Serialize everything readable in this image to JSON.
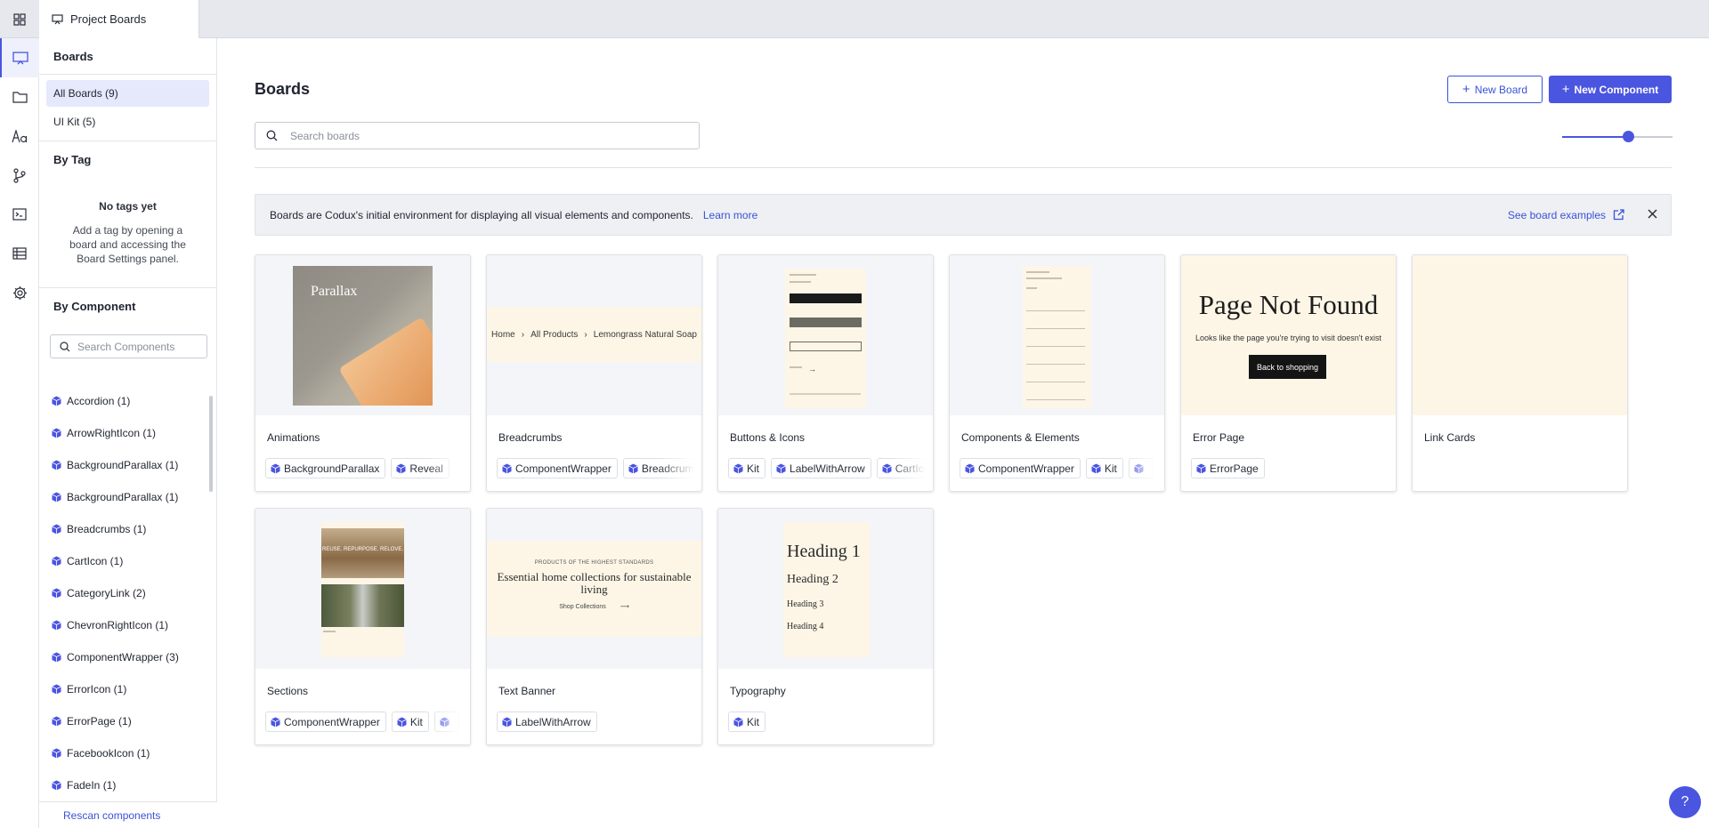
{
  "top_tab": {
    "label": "Project Boards"
  },
  "sidebar": {
    "boards_heading": "Boards",
    "board_filters": [
      {
        "label": "All Boards (9)",
        "active": true
      },
      {
        "label": "UI Kit (5)",
        "active": false
      }
    ],
    "by_tag_heading": "By Tag",
    "no_tags_title": "No tags yet",
    "no_tags_body": "Add a tag by opening a board and accessing the Board Settings panel.",
    "by_component_heading": "By Component",
    "component_search_placeholder": "Search Components",
    "components": [
      "Accordion (1)",
      "ArrowRightIcon (1)",
      "BackgroundParallax (1)",
      "BackgroundParallax (1)",
      "Breadcrumbs (1)",
      "CartIcon (1)",
      "CategoryLink (2)",
      "ChevronRightIcon (1)",
      "ComponentWrapper (3)",
      "ErrorIcon (1)",
      "ErrorPage (1)",
      "FacebookIcon (1)",
      "FadeIn (1)"
    ],
    "rescan_label": "Rescan components"
  },
  "main": {
    "title": "Boards",
    "new_board_label": "New Board",
    "new_component_label": "New Component",
    "search_placeholder": "Search boards",
    "zoom_level": 0.6,
    "banner": {
      "text": "Boards are Codux's initial environment for displaying all visual elements and components.",
      "learn_more": "Learn more",
      "examples": "See board examples"
    },
    "boards": [
      {
        "title": "Animations",
        "chips": [
          "BackgroundParallax",
          "Reveal"
        ],
        "thumb": "parallax"
      },
      {
        "title": "Breadcrumbs",
        "chips": [
          "ComponentWrapper",
          "Breadcrumbs"
        ],
        "thumb": "breadcrumbs"
      },
      {
        "title": "Buttons & Icons",
        "chips": [
          "Kit",
          "LabelWithArrow",
          "CartIcon"
        ],
        "thumb": "buttons"
      },
      {
        "title": "Components & Elements",
        "chips": [
          "ComponentWrapper",
          "Kit",
          ""
        ],
        "thumb": "components"
      },
      {
        "title": "Error Page",
        "chips": [
          "ErrorPage"
        ],
        "thumb": "error"
      },
      {
        "title": "Link Cards",
        "chips": [],
        "thumb": "blank"
      },
      {
        "title": "Sections",
        "chips": [
          "ComponentWrapper",
          "Kit",
          ""
        ],
        "thumb": "sections"
      },
      {
        "title": "Text Banner",
        "chips": [
          "LabelWithArrow"
        ],
        "thumb": "textbanner"
      },
      {
        "title": "Typography",
        "chips": [
          "Kit"
        ],
        "thumb": "typography"
      }
    ],
    "thumb_text": {
      "parallax": "Parallax",
      "crumbs": [
        "Home",
        "All Products",
        "Lemongrass Natural Soap"
      ],
      "error_title": "Page Not Found",
      "error_sub": "Looks like the page you're trying to visit doesn't exist",
      "error_button": "Back to shopping",
      "banner_kicker": "PRODUCTS OF THE HIGHEST STANDARDS",
      "banner_title": "Essential home collections for sustainable living",
      "banner_link": "Shop Collections",
      "sections_caption": "REUSE. REPURPOSE. RELOVE.",
      "typo_headings": [
        "Heading 1",
        "Heading 2",
        "Heading 3",
        "Heading 4"
      ]
    }
  },
  "help_label": "?",
  "colors": {
    "accent": "#4a55e0",
    "link": "#3a52d8",
    "cream": "#fdf6e7"
  }
}
